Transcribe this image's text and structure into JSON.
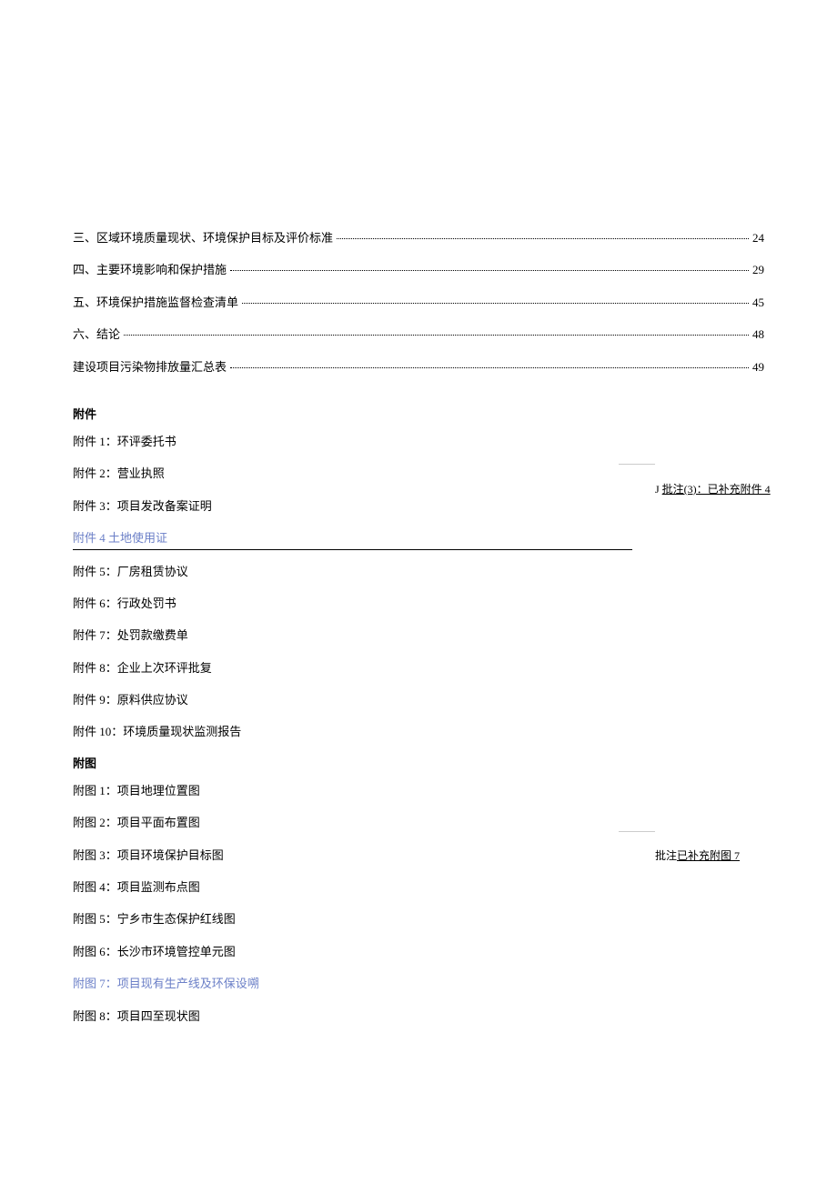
{
  "toc": [
    {
      "text": "三、区域环境质量现状、环境保护目标及评价标准",
      "page": "24"
    },
    {
      "text": "四、主要环境影响和保护措施",
      "page": "29"
    },
    {
      "text": "五、环境保护措施监督检查清单",
      "page": "45"
    },
    {
      "text": "六、结论",
      "page": "48"
    },
    {
      "text": "建设项目污染物排放量汇总表",
      "page": "49"
    }
  ],
  "attachments_heading": "附件",
  "attachments": [
    {
      "label": "附件 1：环评委托书"
    },
    {
      "label": "附件 2：营业执照"
    },
    {
      "label": "附件 3：项目发改备案证明"
    },
    {
      "label": "附件 4 土地使用证",
      "highlighted": true
    },
    {
      "label": "附件 5：厂房租赁协议"
    },
    {
      "label": "附件 6：行政处罚书"
    },
    {
      "label": "附件 7：处罚款缴费单"
    },
    {
      "label": "附件 8：企业上次环评批复"
    },
    {
      "label": "附件 9：原料供应协议"
    },
    {
      "label": "附件 10：环境质量现状监测报告"
    }
  ],
  "figures_heading": "附图",
  "figures": [
    {
      "label": "附图 1：项目地理位置图"
    },
    {
      "label": "附图 2：项目平面布置图"
    },
    {
      "label": "附图 3：项目环境保护目标图"
    },
    {
      "label": "附图 4：项目监测布点图"
    },
    {
      "label": "附图 5：宁乡市生态保护红线图"
    },
    {
      "label": "附图 6：长沙市环境管控单元图"
    },
    {
      "label": "附图 7：项目现有生产线及环保设嗍",
      "highlighted": true
    },
    {
      "label": "附图 8：项目四至现状图"
    }
  ],
  "annotations": {
    "a1_prefix": "J ",
    "a1_label": "批注(3)：已补充附件 4",
    "a2_prefix": "批注",
    "a2_label": "已补充附图 7"
  }
}
